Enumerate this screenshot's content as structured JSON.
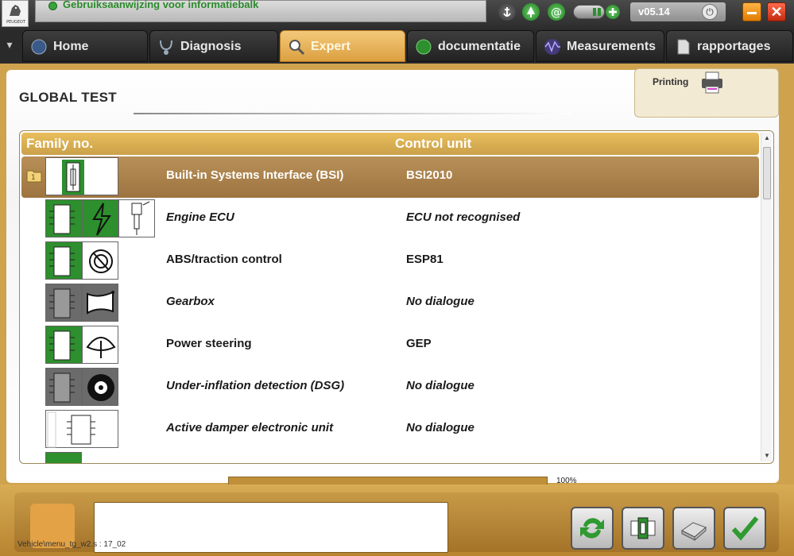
{
  "topbar": {
    "logo_brand": "PEUGEOT",
    "info_text": "Gebruiksaanwijzing voor informatiebalk",
    "version": "v05.14",
    "icons": [
      "anchor-icon",
      "tree-icon",
      "at-icon",
      "battery-icon",
      "help-icon"
    ]
  },
  "tabs": [
    {
      "label": "Home",
      "icon": "home-globe-icon"
    },
    {
      "label": "Diagnosis",
      "icon": "stethoscope-icon"
    },
    {
      "label": "Expert",
      "icon": "magnifier-icon",
      "active": true
    },
    {
      "label": "documentatie",
      "icon": "globe-green-icon"
    },
    {
      "label": "Measurements",
      "icon": "wave-icon"
    },
    {
      "label": "rapportages",
      "icon": "document-icon"
    }
  ],
  "page": {
    "title": "GLOBAL TEST",
    "printing_label": "Printing"
  },
  "table": {
    "columns": [
      "Family no.",
      "Control unit"
    ],
    "rows": [
      {
        "name": "Built-in Systems Interface (BSI)",
        "unit": "BSI2010",
        "selected": true,
        "italic": false,
        "folder": "1"
      },
      {
        "name": "Engine ECU",
        "unit": "ECU not recognised",
        "selected": false,
        "italic": true
      },
      {
        "name": "ABS/traction control",
        "unit": "ESP81",
        "selected": false,
        "italic": false
      },
      {
        "name": "Gearbox",
        "unit": "No dialogue",
        "selected": false,
        "italic": true
      },
      {
        "name": "Power steering",
        "unit": "GEP",
        "selected": false,
        "italic": false
      },
      {
        "name": "Under-inflation detection (DSG)",
        "unit": "No dialogue",
        "selected": false,
        "italic": true
      },
      {
        "name": "Active damper electronic unit",
        "unit": "No dialogue",
        "selected": false,
        "italic": true
      }
    ]
  },
  "progress": {
    "value": 1.0,
    "label": "100%"
  },
  "bottom": {
    "buttons": [
      "refresh-icon",
      "ecu-icon",
      "printer-icon",
      "checkmark-icon"
    ]
  },
  "status": "Vehicle\\menu_tg_w2.s : 17_02",
  "colors": {
    "accent": "#cfa24d",
    "selected_row": "#a57b45",
    "green": "#2d8f2d"
  }
}
